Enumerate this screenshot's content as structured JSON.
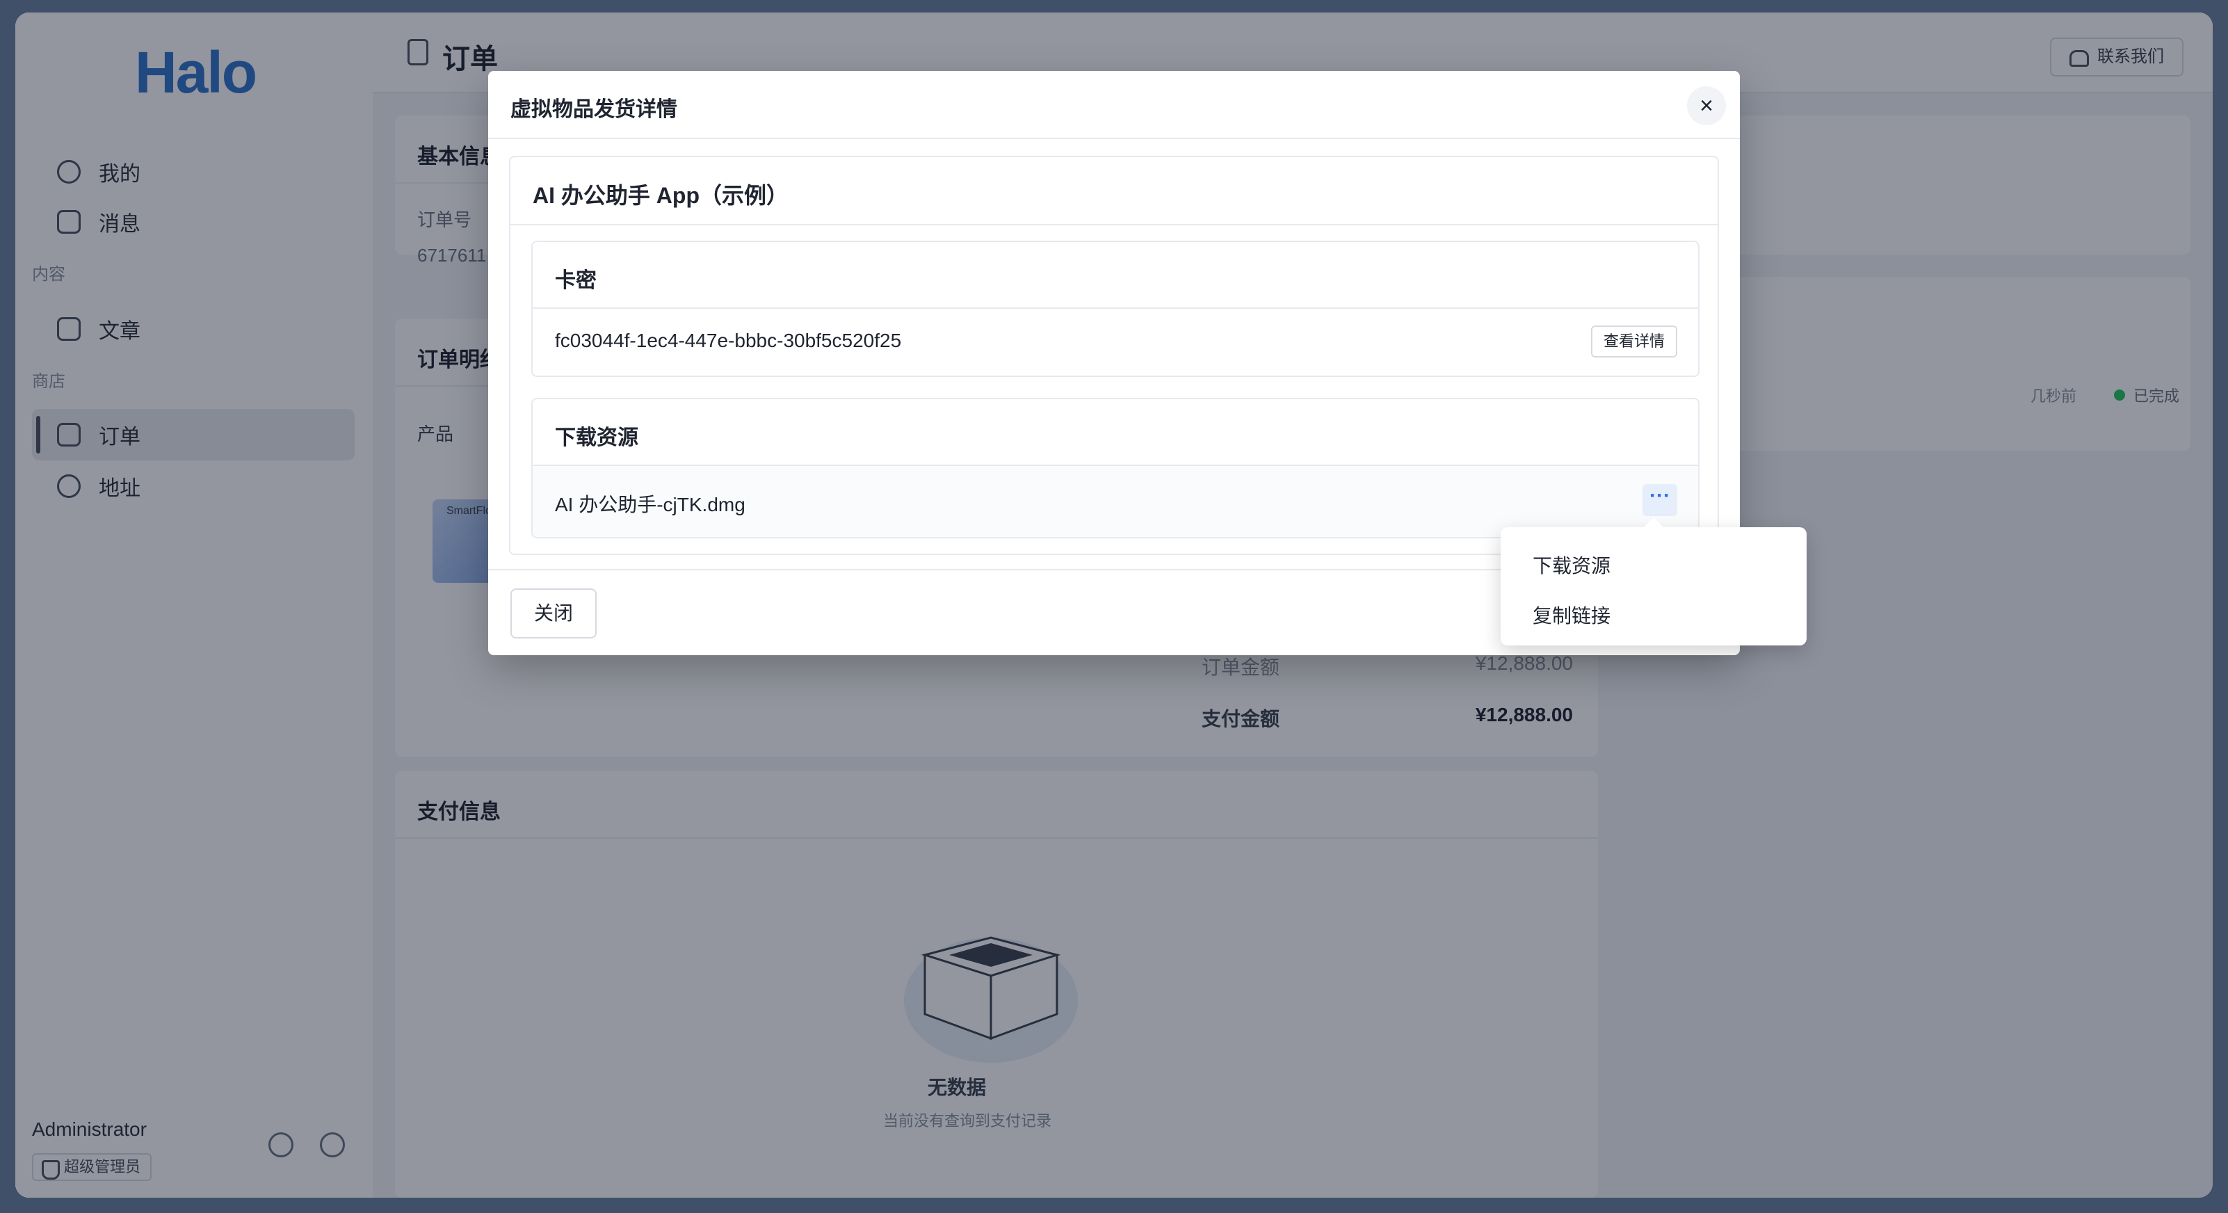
{
  "sidebar": {
    "logo": "Halo",
    "items": [
      {
        "label": "我的"
      },
      {
        "label": "消息"
      },
      {
        "label": "文章"
      },
      {
        "label": "订单"
      },
      {
        "label": "地址"
      }
    ],
    "sections": [
      "内容",
      "商店"
    ],
    "user": {
      "name": "Administrator",
      "role": "超级管理员"
    }
  },
  "header": {
    "title": "订单",
    "contact": "联系我们"
  },
  "background": {
    "basic_info": "基本信息",
    "order_no_label": "订单号",
    "order_no_value": "6717611",
    "order_detail": "订单明细",
    "product_col": "产品",
    "thumb_text": "SmartFlow",
    "order_amount_label": "订单金额",
    "order_amount_value": "¥12,888.00",
    "pay_amount_label": "支付金额",
    "pay_amount_value": "¥12,888.00",
    "payment_info": "支付信息",
    "empty_title": "无数据",
    "empty_desc": "当前没有查询到支付记录",
    "time_ago": "几秒前",
    "status": "已完成"
  },
  "modal": {
    "title": "虚拟物品发货详情",
    "product_title": "AI 办公助手 App（示例）",
    "card_key": {
      "heading": "卡密",
      "value": "fc03044f-1ec4-447e-bbbc-30bf5c520f25",
      "view_button": "查看详情"
    },
    "download": {
      "heading": "下载资源",
      "file": "AI 办公助手-cjTK.dmg",
      "more": "···"
    },
    "close_button": "关闭"
  },
  "dropdown": {
    "items": [
      "下载资源",
      "复制链接"
    ]
  },
  "colors": {
    "accent": "#2f74c9",
    "status_green": "#22c55e"
  }
}
